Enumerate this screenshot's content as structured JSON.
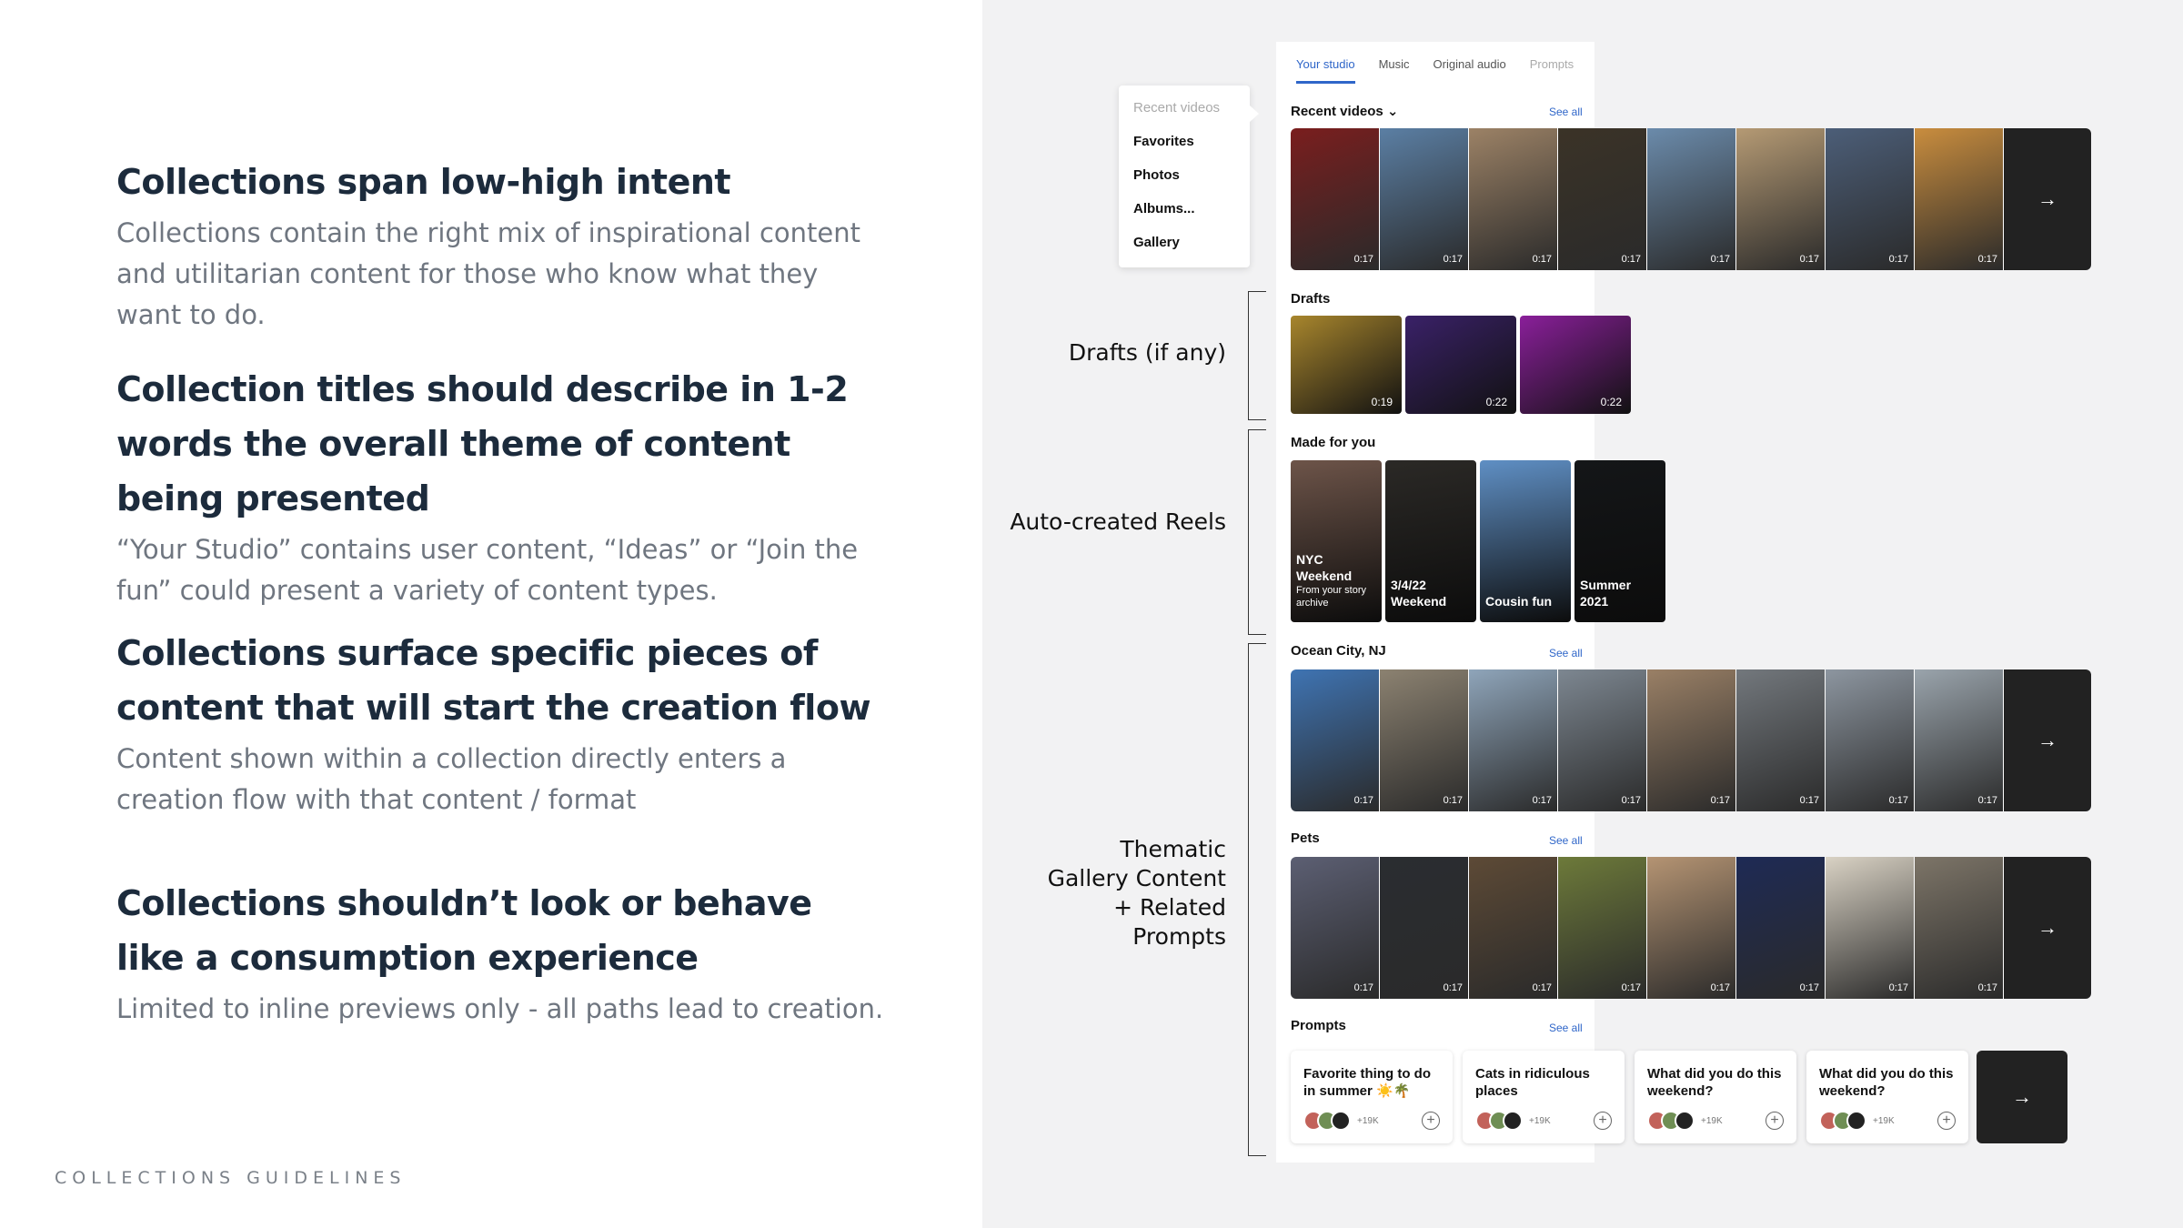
{
  "sections": [
    {
      "title": "Collections span low-high intent",
      "body": "Collections contain the right mix of inspirational content and utilitarian content for those who know what they want to do."
    },
    {
      "title": "Collection titles should describe in 1-2 words the overall theme of content being presented",
      "body": "“Your Studio” contains user content, “Ideas” or “Join the fun” could present a variety of content types."
    },
    {
      "title": "Collections surface specific pieces of content that will start the creation flow",
      "body": "Content shown within a collection directly enters a creation flow with that content / format"
    },
    {
      "title": "Collections shouldn’t look or behave like a consumption experience",
      "body": "Limited to inline previews only - all paths lead to creation."
    }
  ],
  "footer": "COLLECTIONS GUIDELINES",
  "tabs": [
    "Your studio",
    "Music",
    "Original audio",
    "Prompts"
  ],
  "dropdown": [
    "Recent videos",
    "Favorites",
    "Photos",
    "Albums...",
    "Gallery"
  ],
  "recent": {
    "title": "Recent videos ⌄",
    "see_all": "See all",
    "durations": [
      "0:17",
      "0:17",
      "0:17",
      "0:17",
      "0:17",
      "0:17",
      "0:17",
      "0:17"
    ],
    "colors": [
      "#7a1e1e",
      "#5b7fa4",
      "#9c8266",
      "#3b3327",
      "#6b8bab",
      "#b59a74",
      "#4c5e78",
      "#c98d3e"
    ]
  },
  "drafts": {
    "title": "Drafts",
    "durations": [
      "0:19",
      "0:22",
      "0:22"
    ],
    "colors": [
      "#a8862d",
      "#3a2168",
      "#8a1f9a"
    ]
  },
  "made_for_you": {
    "title": "Made for you",
    "reels": [
      {
        "line1": "NYC",
        "line2": "Weekend",
        "sub": "From your story archive",
        "color": "#6d5449"
      },
      {
        "line1": "3/4/22",
        "line2": "Weekend",
        "sub": "",
        "color": "#2b2926"
      },
      {
        "line1": "Cousin fun",
        "line2": "",
        "sub": "",
        "color": "#5f8fc4"
      },
      {
        "line1": "Summer",
        "line2": "2021",
        "sub": "",
        "color": "#141618"
      }
    ]
  },
  "ocean": {
    "title": "Ocean City, NJ",
    "see_all": "See all",
    "durations": [
      "0:17",
      "0:17",
      "0:17",
      "0:17",
      "0:17",
      "0:17",
      "0:17",
      "0:17"
    ],
    "colors": [
      "#3f74b3",
      "#8c8271",
      "#8fa5ba",
      "#7d8791",
      "#9a8066",
      "#73787d",
      "#8d96a0",
      "#9aa4ac"
    ]
  },
  "pets": {
    "title": "Pets",
    "see_all": "See all",
    "durations": [
      "0:17",
      "0:17",
      "0:17",
      "0:17",
      "0:17",
      "0:17",
      "0:17",
      "0:17"
    ],
    "colors": [
      "#5c5f73",
      "#2a2d31",
      "#5d4a36",
      "#6d7a3a",
      "#b59473",
      "#1e2a55",
      "#d9d2c4",
      "#7d7568"
    ]
  },
  "prompts": {
    "title": "Prompts",
    "see_all": "See all",
    "cards": [
      {
        "text": "Favorite thing to do in summer ☀️🌴",
        "count": "+19K"
      },
      {
        "text": "Cats in ridiculous places",
        "count": "+19K"
      },
      {
        "text": "What did you do this weekend?",
        "count": "+19K"
      },
      {
        "text": "What did you do this weekend?",
        "count": "+19K"
      }
    ]
  },
  "arrow": "→",
  "annotations": {
    "drafts": "Drafts (if any)",
    "reels": "Auto-created Reels",
    "thematic": "Thematic Gallery Content + Related Prompts"
  }
}
